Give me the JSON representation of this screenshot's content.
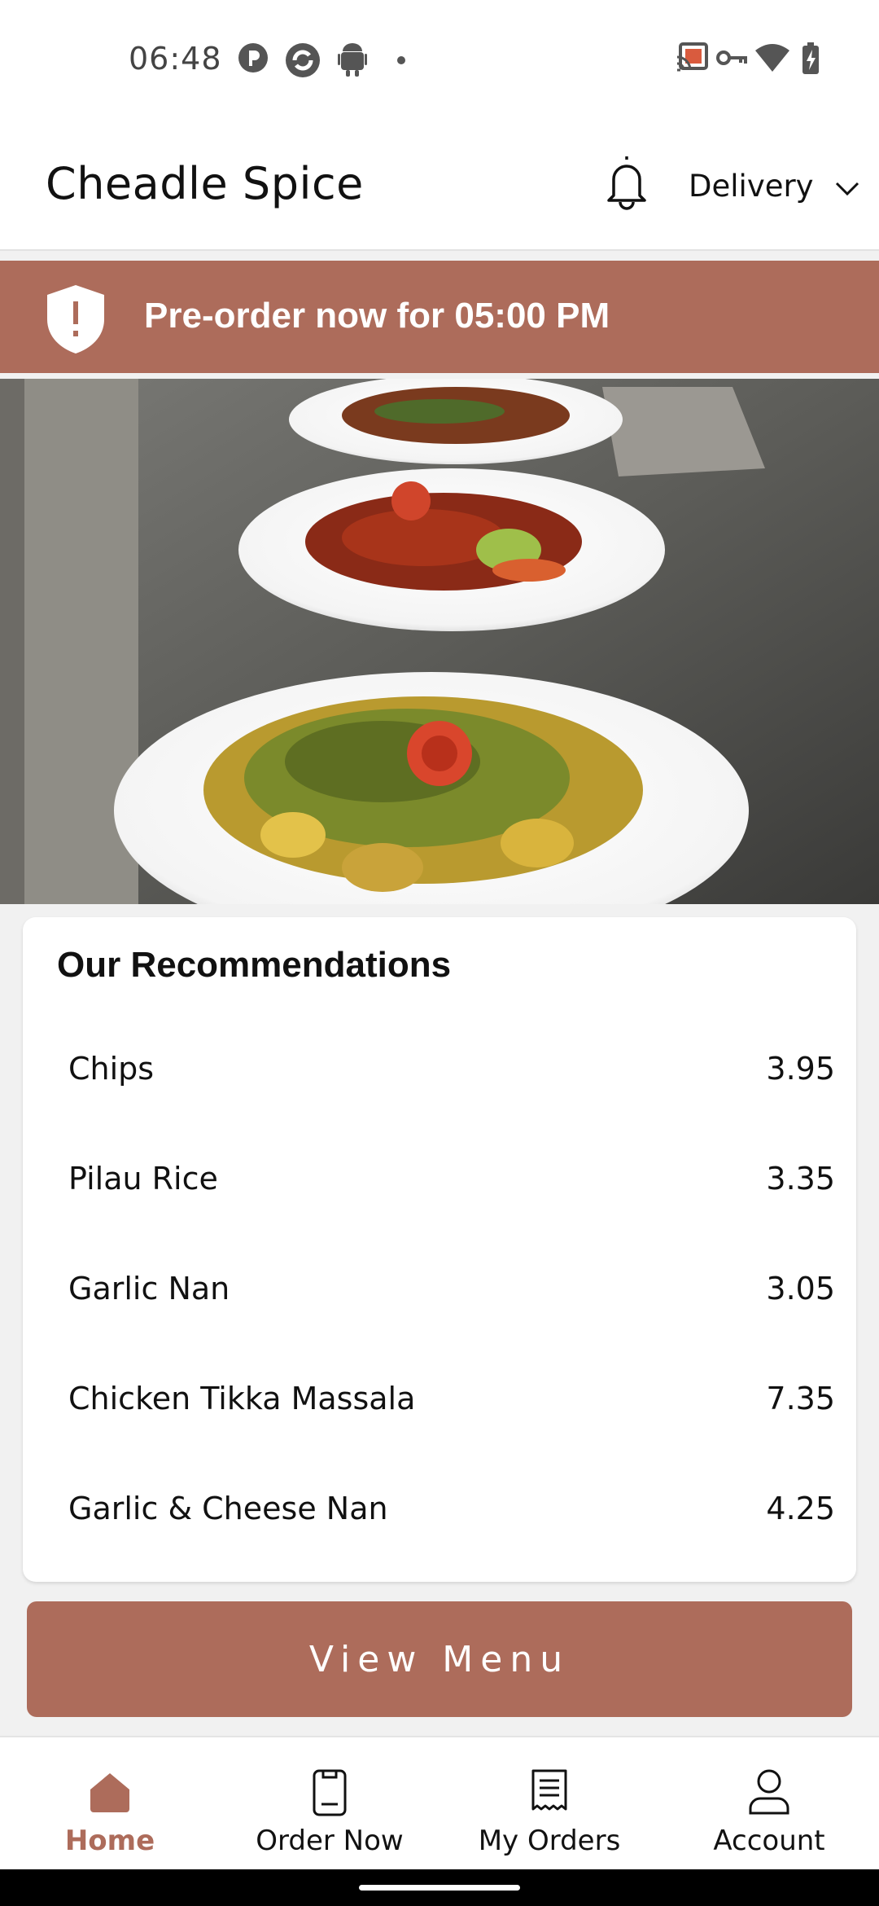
{
  "status_bar": {
    "time": "06:48",
    "left_icons": [
      "p-icon",
      "refresh-icon",
      "android-icon",
      "dot-icon"
    ],
    "right_icons": [
      "cast-icon",
      "vpn-key-icon",
      "wifi-icon",
      "battery-charging-icon"
    ]
  },
  "header": {
    "title": "Cheadle Spice",
    "notification_icon": "bell-icon",
    "order_type": "Delivery"
  },
  "banner": {
    "text": "Pre-order now for 05:00 PM",
    "icon": "shield-alert-icon",
    "color": "#ad6c5b"
  },
  "hero": {
    "description_icon": "food-photo"
  },
  "recommendations": {
    "title": "Our Recommendations",
    "items": [
      {
        "name": "Chips",
        "price": "3.95"
      },
      {
        "name": "Pilau Rice",
        "price": "3.35"
      },
      {
        "name": "Garlic Nan",
        "price": "3.05"
      },
      {
        "name": "Chicken Tikka Massala",
        "price": "7.35"
      },
      {
        "name": "Garlic & Cheese Nan",
        "price": "4.25"
      }
    ]
  },
  "view_menu": {
    "label": "View Menu"
  },
  "bottom_nav": {
    "items": [
      {
        "label": "Home",
        "icon": "home-icon",
        "active": true
      },
      {
        "label": "Order Now",
        "icon": "order-icon",
        "active": false
      },
      {
        "label": "My Orders",
        "icon": "receipt-icon",
        "active": false
      },
      {
        "label": "Account",
        "icon": "account-icon",
        "active": false
      }
    ]
  },
  "colors": {
    "accent": "#ad6c5b",
    "background": "#f1f1f1",
    "card": "#ffffff"
  }
}
